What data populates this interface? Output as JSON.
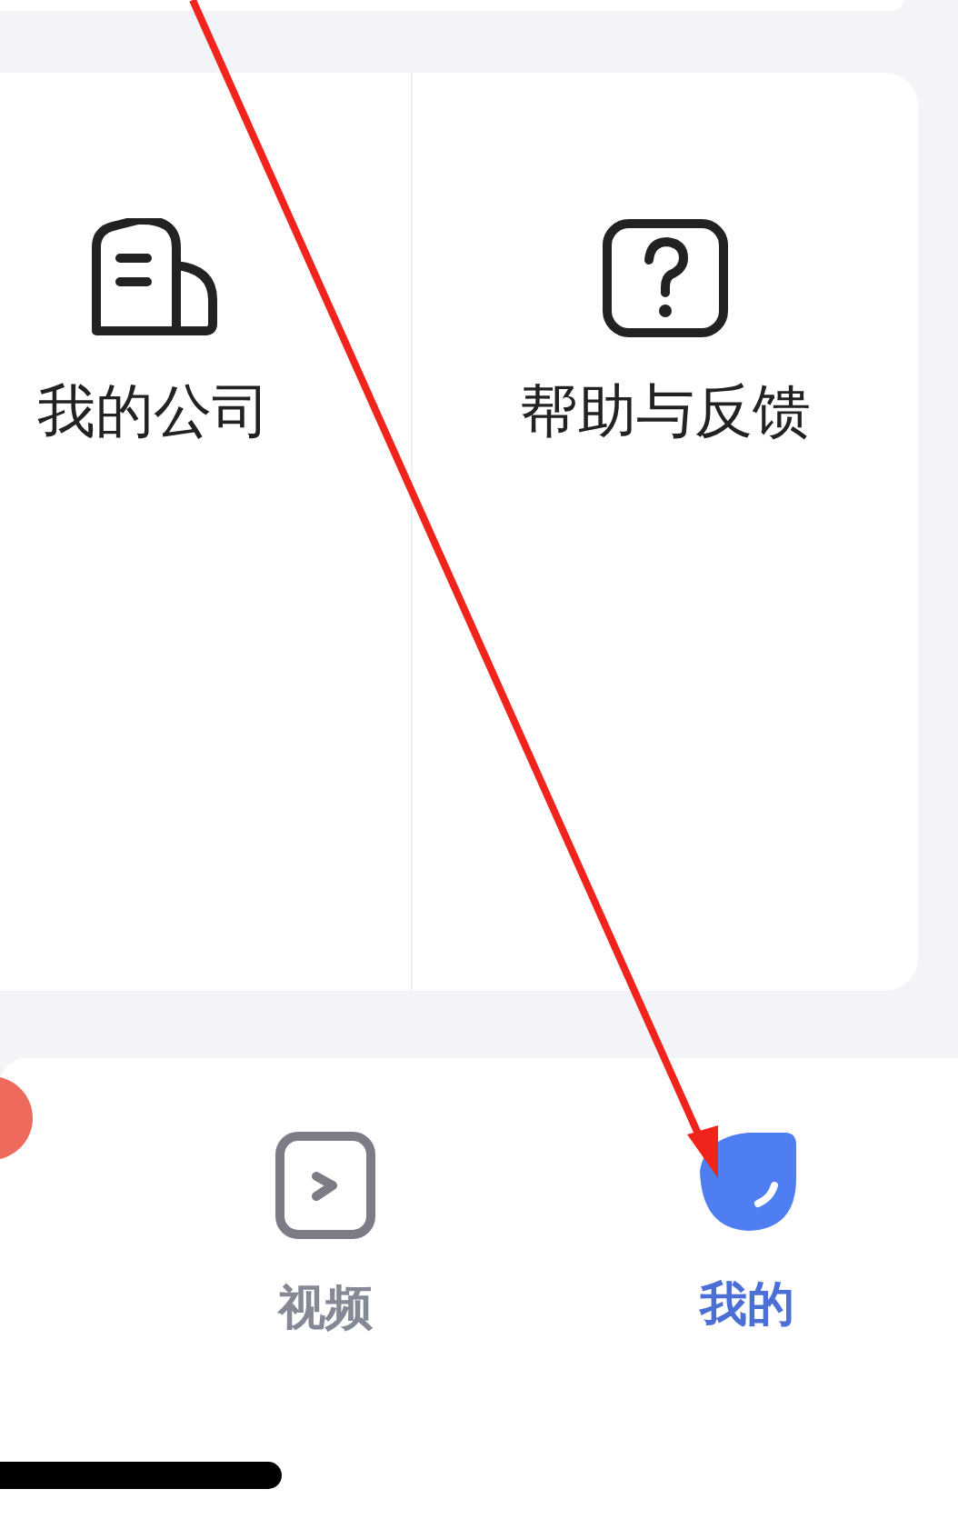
{
  "menu_card": {
    "items": [
      {
        "label": "我的公司",
        "kind": "company"
      },
      {
        "label": "帮助与反馈",
        "kind": "help"
      }
    ]
  },
  "tab_bar": {
    "tabs": [
      {
        "label": "视频",
        "kind": "video",
        "selected": false
      },
      {
        "label": "我的",
        "kind": "me",
        "selected": true
      }
    ]
  }
}
